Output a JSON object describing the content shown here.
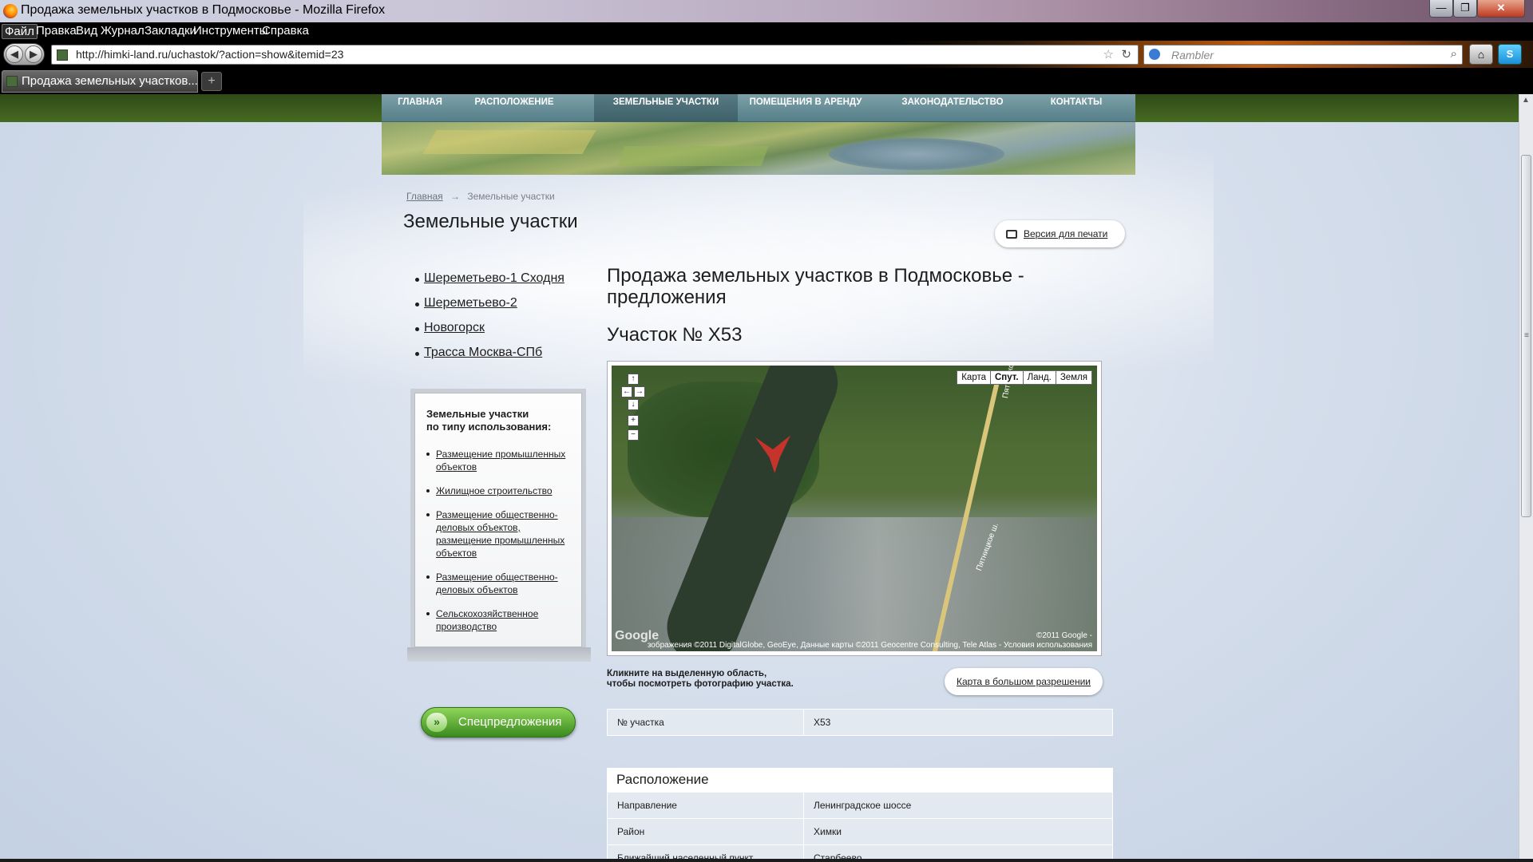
{
  "window": {
    "title": "Продажа земельных участков в Подмосковье - Mozilla Firefox",
    "min": "—",
    "max": "❐",
    "close": "✕"
  },
  "menu": [
    "Файл",
    "Правка",
    "Вид",
    "Журнал",
    "Закладки",
    "Инструменты",
    "Справка"
  ],
  "browser": {
    "url": "http://himki-land.ru/uchastok/?action=show&itemid=23",
    "search_placeholder": "Rambler",
    "tab_title": "Продажа земельных участков...",
    "new_tab": "+",
    "back": "◀",
    "forward": "▶",
    "star": "☆",
    "reload": "↻",
    "search_icon": "⌕",
    "home": "⌂",
    "addon": "S"
  },
  "site_nav": [
    "ГЛАВНАЯ",
    "РАСПОЛОЖЕНИЕ",
    "ЗЕМЕЛЬНЫЕ УЧАСТКИ",
    "ПОМЕЩЕНИЯ В АРЕНДУ",
    "ЗАКОНОДАТЕЛЬСТВО",
    "КОНТАКТЫ"
  ],
  "breadcrumb": {
    "home": "Главная",
    "sep": "→",
    "current": "Земельные участки"
  },
  "page_title": "Земельные участки",
  "print_label": "Версия для печати",
  "side_links": [
    "Шереметьево-1 Сходня",
    "Шереметьево-2",
    "Новогорск",
    "Трасса Москва-СПб"
  ],
  "usage_box": {
    "title_line1": "Земельные участки",
    "title_line2": "по типу использования:",
    "items": [
      "Размещение промышленных объектов",
      "Жилищное строительство",
      "Размещение общественно-деловых объектов, размещение промышленных объектов",
      "Размещение общественно-деловых объектов",
      "Сельскохозяйственное производство"
    ]
  },
  "special_offers": "Спецпредложения",
  "special_arrow": "»",
  "main": {
    "heading": "Продажа земельных участков в Подмосковье - предложения",
    "subheading": "Участок № X53"
  },
  "map": {
    "types": [
      "Карта",
      "Спут.",
      "Ланд.",
      "Земля"
    ],
    "selected_type": "Спут.",
    "controls": {
      "up": "↑",
      "left": "←",
      "right": "→",
      "down": "↓",
      "zoom_in": "+",
      "zoom_out": "−"
    },
    "road_label_1": "Пятницкое",
    "road_label_2": "Пятницкое ш.",
    "copyright_1": "©2011 Google -",
    "copyright_2": "зображения ©2011 DigitalGlobe, GeoEye, Данные карты ©2011 Geocentre Consulting, Tele Atlas - Условия использования",
    "google": "Google"
  },
  "map_hint_1": "Кликните на выделенную область,",
  "map_hint_2": "чтобы посмотреть фотографию участка.",
  "bigmap_label": "Карта в большом разрешении",
  "plot_table": [
    {
      "key": "№ участка",
      "value": "X53"
    }
  ],
  "location": {
    "heading": "Расположение",
    "rows": [
      {
        "key": "Направление",
        "value": "Ленинградское шоссе"
      },
      {
        "key": "Район",
        "value": "Химки"
      },
      {
        "key": "Ближайший населенный пункт",
        "value": "Старбеево"
      }
    ]
  }
}
